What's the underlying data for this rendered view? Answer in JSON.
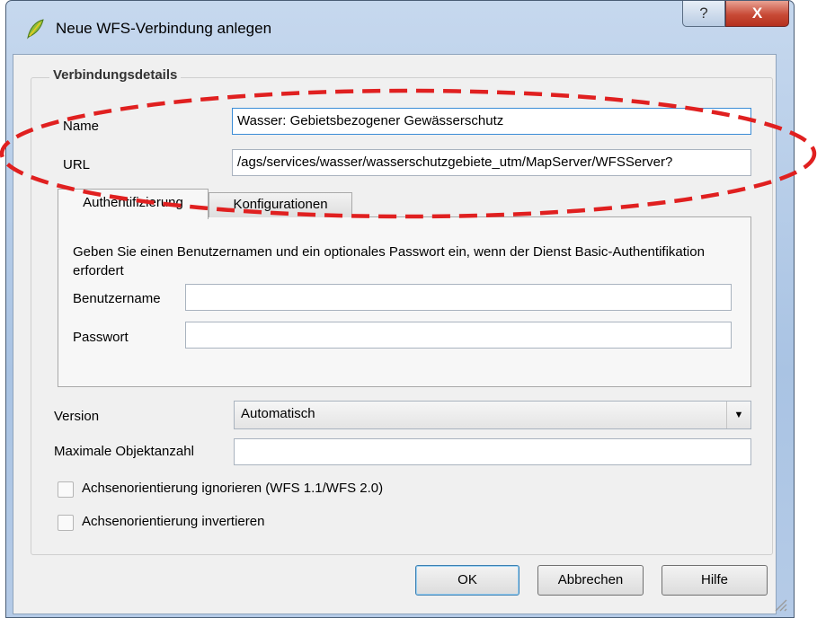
{
  "window": {
    "title": "Neue WFS-Verbindung anlegen",
    "help_glyph": "?",
    "close_glyph": "X"
  },
  "group": {
    "title": "Verbindungsdetails"
  },
  "fields": {
    "name": {
      "label": "Name",
      "value": "Wasser: Gebietsbezogener Gewässerschutz"
    },
    "url": {
      "label": "URL",
      "value": "/ags/services/wasser/wasserschutzgebiete_utm/MapServer/WFSServer?"
    }
  },
  "tabs": [
    {
      "label": "Authentifizierung",
      "active": true
    },
    {
      "label": "Konfigurationen",
      "active": false
    }
  ],
  "auth": {
    "description": "Geben Sie einen Benutzernamen und ein optionales Passwort ein, wenn der Dienst Basic-Authentifikation erfordert",
    "username_label": "Benutzername",
    "username_value": "",
    "password_label": "Passwort",
    "password_value": ""
  },
  "version": {
    "label": "Version",
    "selected": "Automatisch"
  },
  "max_objects": {
    "label": "Maximale Objektanzahl",
    "value": ""
  },
  "checkboxes": [
    {
      "label": "Achsenorientierung ignorieren (WFS 1.1/WFS 2.0)",
      "checked": false
    },
    {
      "label": "Achsenorientierung invertieren",
      "checked": false
    }
  ],
  "buttons": {
    "ok": "OK",
    "cancel": "Abbrechen",
    "help": "Hilfe"
  },
  "annotation": {
    "color": "#e02020",
    "style": "dashed ellipse around Name and URL fields"
  }
}
